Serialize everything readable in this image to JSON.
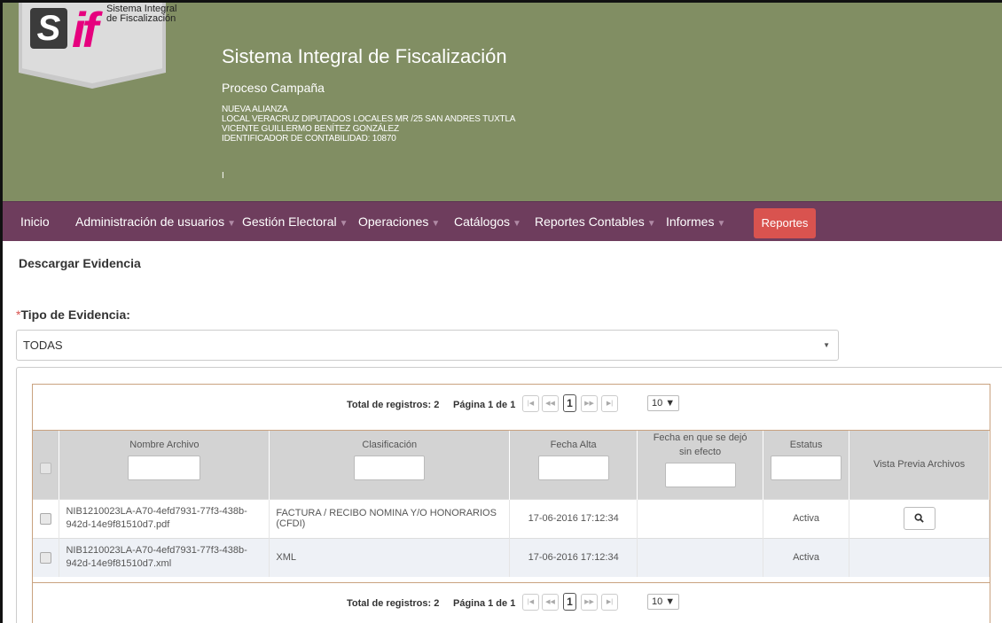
{
  "logo": {
    "s": "S",
    "if": "if",
    "text": "Sistema Integral de Fiscalización"
  },
  "header": {
    "title": "Sistema Integral de Fiscalización",
    "subtitle": "Proceso Campaña",
    "party": "NUEVA ALIANZA",
    "district": "LOCAL VERACRUZ DIPUTADOS LOCALES MR /25 SAN ANDRES TUXTLA",
    "candidate": "VICENTE GUILLERMO BENÍTEZ GONZÁLEZ",
    "account_id": "IDENTIFICADOR DE CONTABILIDAD: 10870",
    "cursor": "I"
  },
  "nav": {
    "items": [
      {
        "label": "Inicio"
      },
      {
        "label": "Administración de usuarios"
      },
      {
        "label": "Gestión Electoral"
      },
      {
        "label": "Operaciones"
      },
      {
        "label": "Catálogos"
      },
      {
        "label": "Reportes Contables"
      },
      {
        "label": "Informes"
      }
    ],
    "reportes": "Reportes"
  },
  "page": {
    "heading": "Descargar Evidencia",
    "required_mark": "*",
    "evidence_label": "Tipo de Evidencia:",
    "evidence_value": "TODAS"
  },
  "pager": {
    "total": "Total de registros: 2",
    "page": "Página 1 de 1",
    "first": "|◀",
    "prev": "◀◀",
    "current": "1",
    "next": "▶▶",
    "last": "▶|",
    "size": "10 ▼"
  },
  "table": {
    "headers": {
      "name": "Nombre Archivo",
      "class": "Clasificación",
      "date": "Fecha Alta",
      "end": "Fecha en que se dejó sin efecto",
      "status": "Estatus",
      "preview": "Vista Previa Archivos"
    },
    "rows": [
      {
        "name": "NIB1210023LA-A70-4efd7931-77f3-438b-942d-14e9f81510d7.pdf",
        "class": "FACTURA / RECIBO NOMINA Y/O HONORARIOS (CFDI)",
        "date": "17-06-2016 17:12:34",
        "end": "",
        "status": "Activa",
        "preview_icon": "search-icon"
      },
      {
        "name": "NIB1210023LA-A70-4efd7931-77f3-438b-942d-14e9f81510d7.xml",
        "class": "XML",
        "date": "17-06-2016 17:12:34",
        "end": "",
        "status": "Activa"
      }
    ]
  },
  "colors": {
    "header_bg": "#818e63",
    "nav_bg": "#6e3d5d",
    "reportes_btn": "#d9534f",
    "logo_if": "#e6007e"
  }
}
